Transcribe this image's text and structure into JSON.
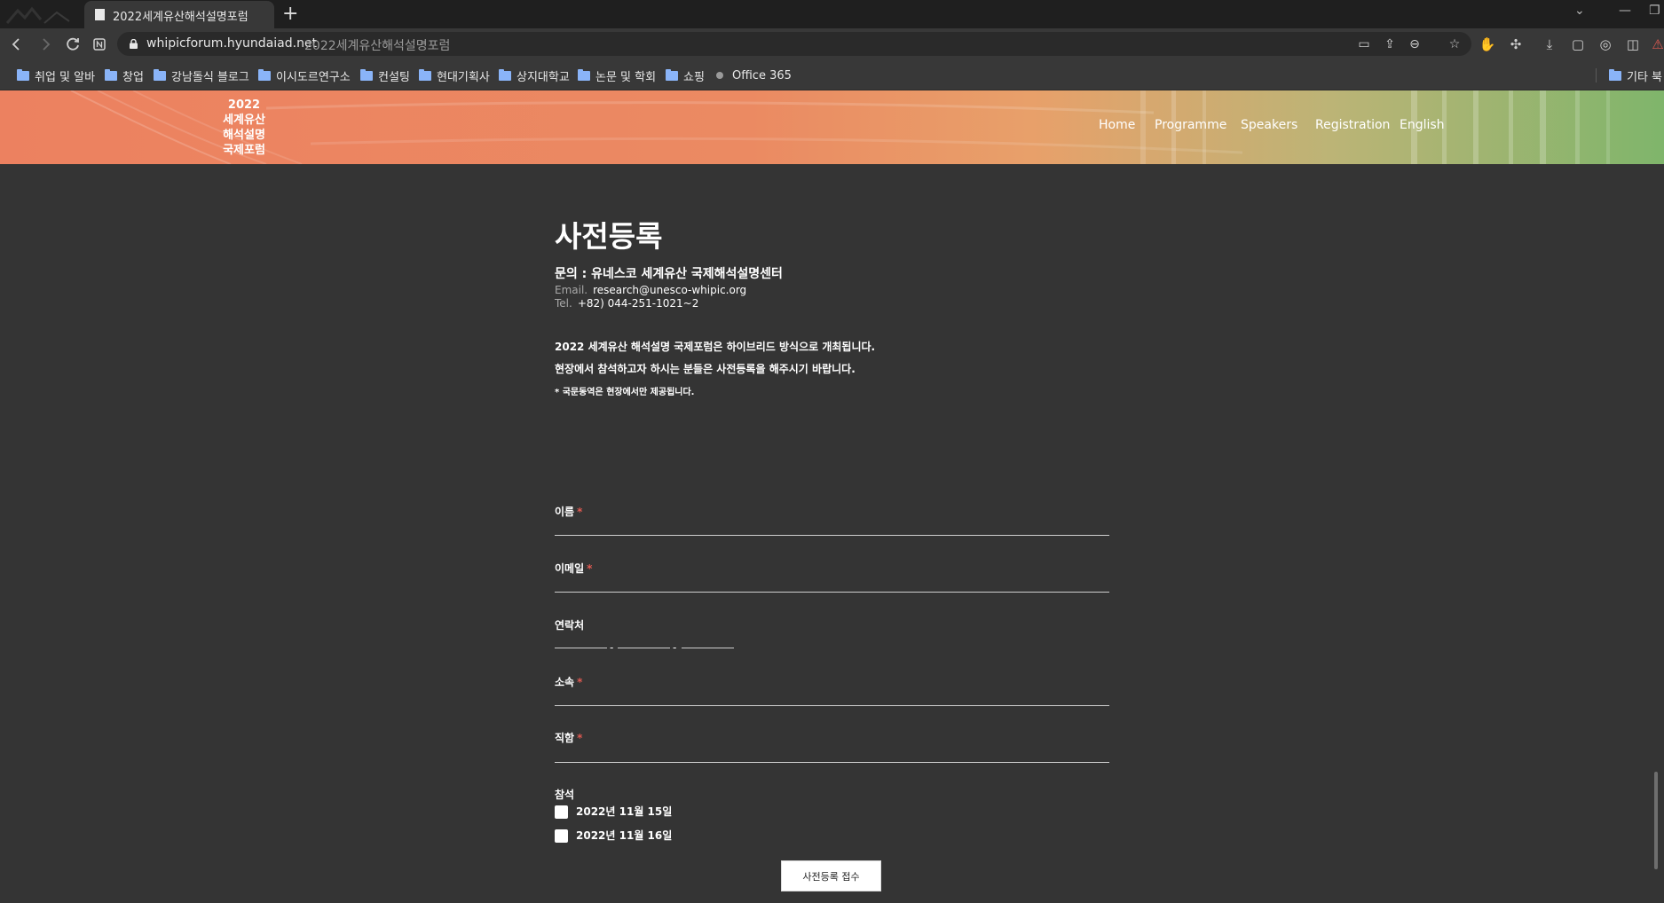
{
  "browser": {
    "tab": {
      "title": "2022세계유산해석설명포럼"
    },
    "new_tab_label": "+",
    "window_controls": {
      "list_tabs": "⌄",
      "minimize": "—",
      "restore": "❐"
    },
    "address": {
      "host": "whipicforum.hyundaiad.net",
      "page_title": "2022세계유산해석설명포럼"
    },
    "icons": {
      "back": "back-arrow-icon",
      "forward": "forward-arrow-icon",
      "reload": "reload-icon",
      "site_info": "notion-icon",
      "omnibox": [
        "cast-icon",
        "share-icon",
        "zoom-icon",
        "favorites-icon"
      ],
      "toolbar": [
        "hand-icon",
        "extensions-icon",
        "download-icon",
        "screen-icon",
        "screenshot-icon",
        "sidebar-icon",
        "warning-icon"
      ]
    },
    "bookmarks": [
      {
        "label": "취업 및 알바",
        "type": "folder"
      },
      {
        "label": "창업",
        "type": "folder"
      },
      {
        "label": "강남돌식 블로그",
        "type": "folder"
      },
      {
        "label": "이시도르연구소",
        "type": "folder"
      },
      {
        "label": "컨설팅",
        "type": "folder"
      },
      {
        "label": "현대기획사",
        "type": "folder"
      },
      {
        "label": "상지대학교",
        "type": "folder"
      },
      {
        "label": "논문 및 학회",
        "type": "folder"
      },
      {
        "label": "쇼핑",
        "type": "folder"
      },
      {
        "label": "Office 365",
        "type": "link"
      }
    ],
    "other_bookmarks": "기타 북"
  },
  "site": {
    "logo": [
      "2022",
      "세계유산",
      "해석설명",
      "국제포럼"
    ],
    "nav": [
      "Home",
      "Programme",
      "Speakers",
      "Registration",
      "English"
    ],
    "colors": {
      "header_start": "#ec8160",
      "header_end": "#7fb56b",
      "background": "#343434",
      "required": "#e05a52"
    }
  },
  "page": {
    "title": "사전등록",
    "contact": {
      "heading": "문의 : 유네스코 세계유산 국제해석설명센터",
      "email_label": "Email.",
      "email": "research@unesco-whipic.org",
      "tel_label": "Tel.",
      "tel": "+82) 044-251-1021~2"
    },
    "notice": [
      "2022 세계유산 해석설명 국제포럼은 하이브리드 방식으로 개최됩니다.",
      "현장에서 참석하고자 하시는 분들은 사전등록을 해주시기 바랍니다."
    ],
    "notice_small": "* 국문동역은 현장에서만 제공됩니다."
  },
  "form": {
    "required_mark": "*",
    "name_label": "이름",
    "email_label": "이메일",
    "phone_label": "연락처",
    "phone_separator": "-",
    "affiliation_label": "소속",
    "position_label": "직함",
    "attendance_label": "참석",
    "attendance_options": [
      "2022년 11월 15일",
      "2022년 11월 16일"
    ],
    "submit_label": "사전등록 접수"
  }
}
